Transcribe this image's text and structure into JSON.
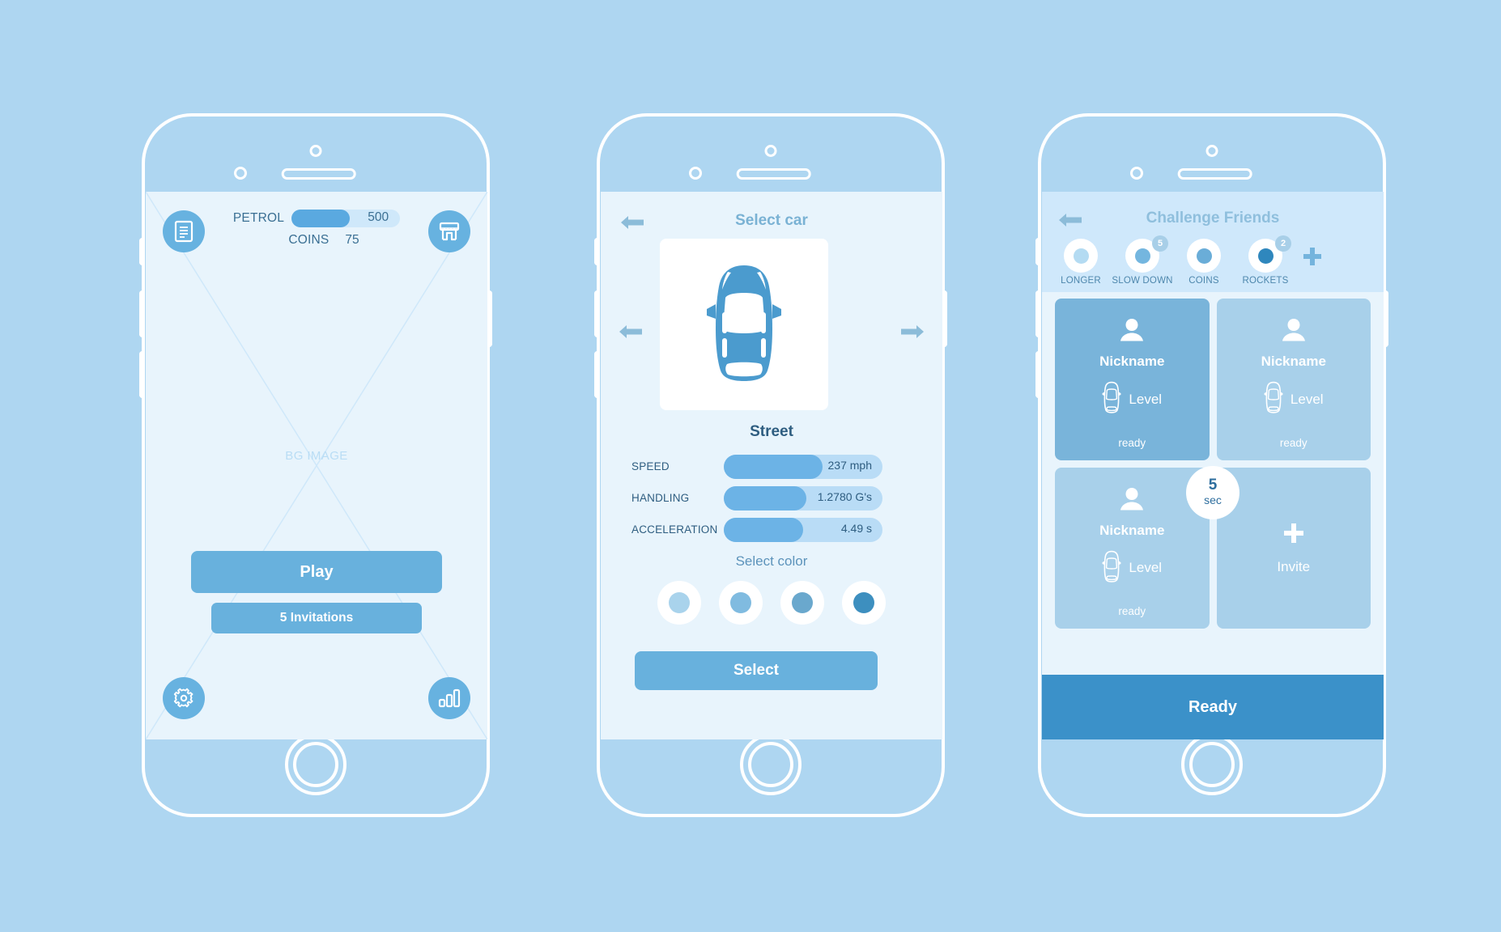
{
  "theme": {
    "page_bg": "#aed6f1",
    "screen_bg": "#e8f4fc",
    "accent": "#68b1dd",
    "accent_dark": "#3b91c9",
    "text_dark": "#2e5d80",
    "text_muted": "#7ab2d4"
  },
  "screen_home": {
    "doc_icon": "document-icon",
    "shop_icon": "shop-icon",
    "gear_icon": "gear-icon",
    "stats_icon": "bar-chart-icon",
    "petrol_label": "PETROL",
    "petrol_value": "500",
    "petrol_fill_percent": 54,
    "coins_label": "COINS",
    "coins_value": "75",
    "bg_placeholder": "BG IMAGE",
    "play_label": "Play",
    "invitations_label": "5 Invitations"
  },
  "screen_select_car": {
    "back_icon": "arrow-left-icon",
    "title": "Select car",
    "prev_icon": "arrow-left-icon",
    "next_icon": "arrow-right-icon",
    "car_icon": "car-top-view-icon",
    "car_name": "Street",
    "stats": [
      {
        "label": "SPEED",
        "value": "237 mph",
        "fill_percent": 62
      },
      {
        "label": "HANDLING",
        "value": "1.2780 G's",
        "fill_percent": 52
      },
      {
        "label": "ACCELERATION",
        "value": "4.49 s",
        "fill_percent": 50
      }
    ],
    "select_color_label": "Select color",
    "colors": [
      "#a9d3ec",
      "#80bbe0",
      "#6aa8cd",
      "#3d8fbf"
    ],
    "select_label": "Select"
  },
  "screen_challenge": {
    "back_icon": "arrow-left-icon",
    "title": "Challenge Friends",
    "powerups": [
      {
        "label": "LONGER",
        "color": "#b4dbf2",
        "badge": ""
      },
      {
        "label": "SLOW DOWN",
        "color": "#74b6df",
        "badge": "5"
      },
      {
        "label": "COINS",
        "color": "#6aadd8",
        "badge": ""
      },
      {
        "label": "ROCKETS",
        "color": "#2f87bd",
        "badge": "2"
      }
    ],
    "add_powerup_icon": "plus-icon",
    "friends": [
      {
        "nickname": "Nickname",
        "level": "Level",
        "status": "ready",
        "active": true
      },
      {
        "nickname": "Nickname",
        "level": "Level",
        "status": "ready",
        "active": false
      },
      {
        "nickname": "Nickname",
        "level": "Level",
        "status": "ready",
        "active": false
      }
    ],
    "invite_label": "Invite",
    "invite_icon": "plus-icon",
    "timer_value": "5",
    "timer_unit": "sec",
    "ready_label": "Ready"
  }
}
